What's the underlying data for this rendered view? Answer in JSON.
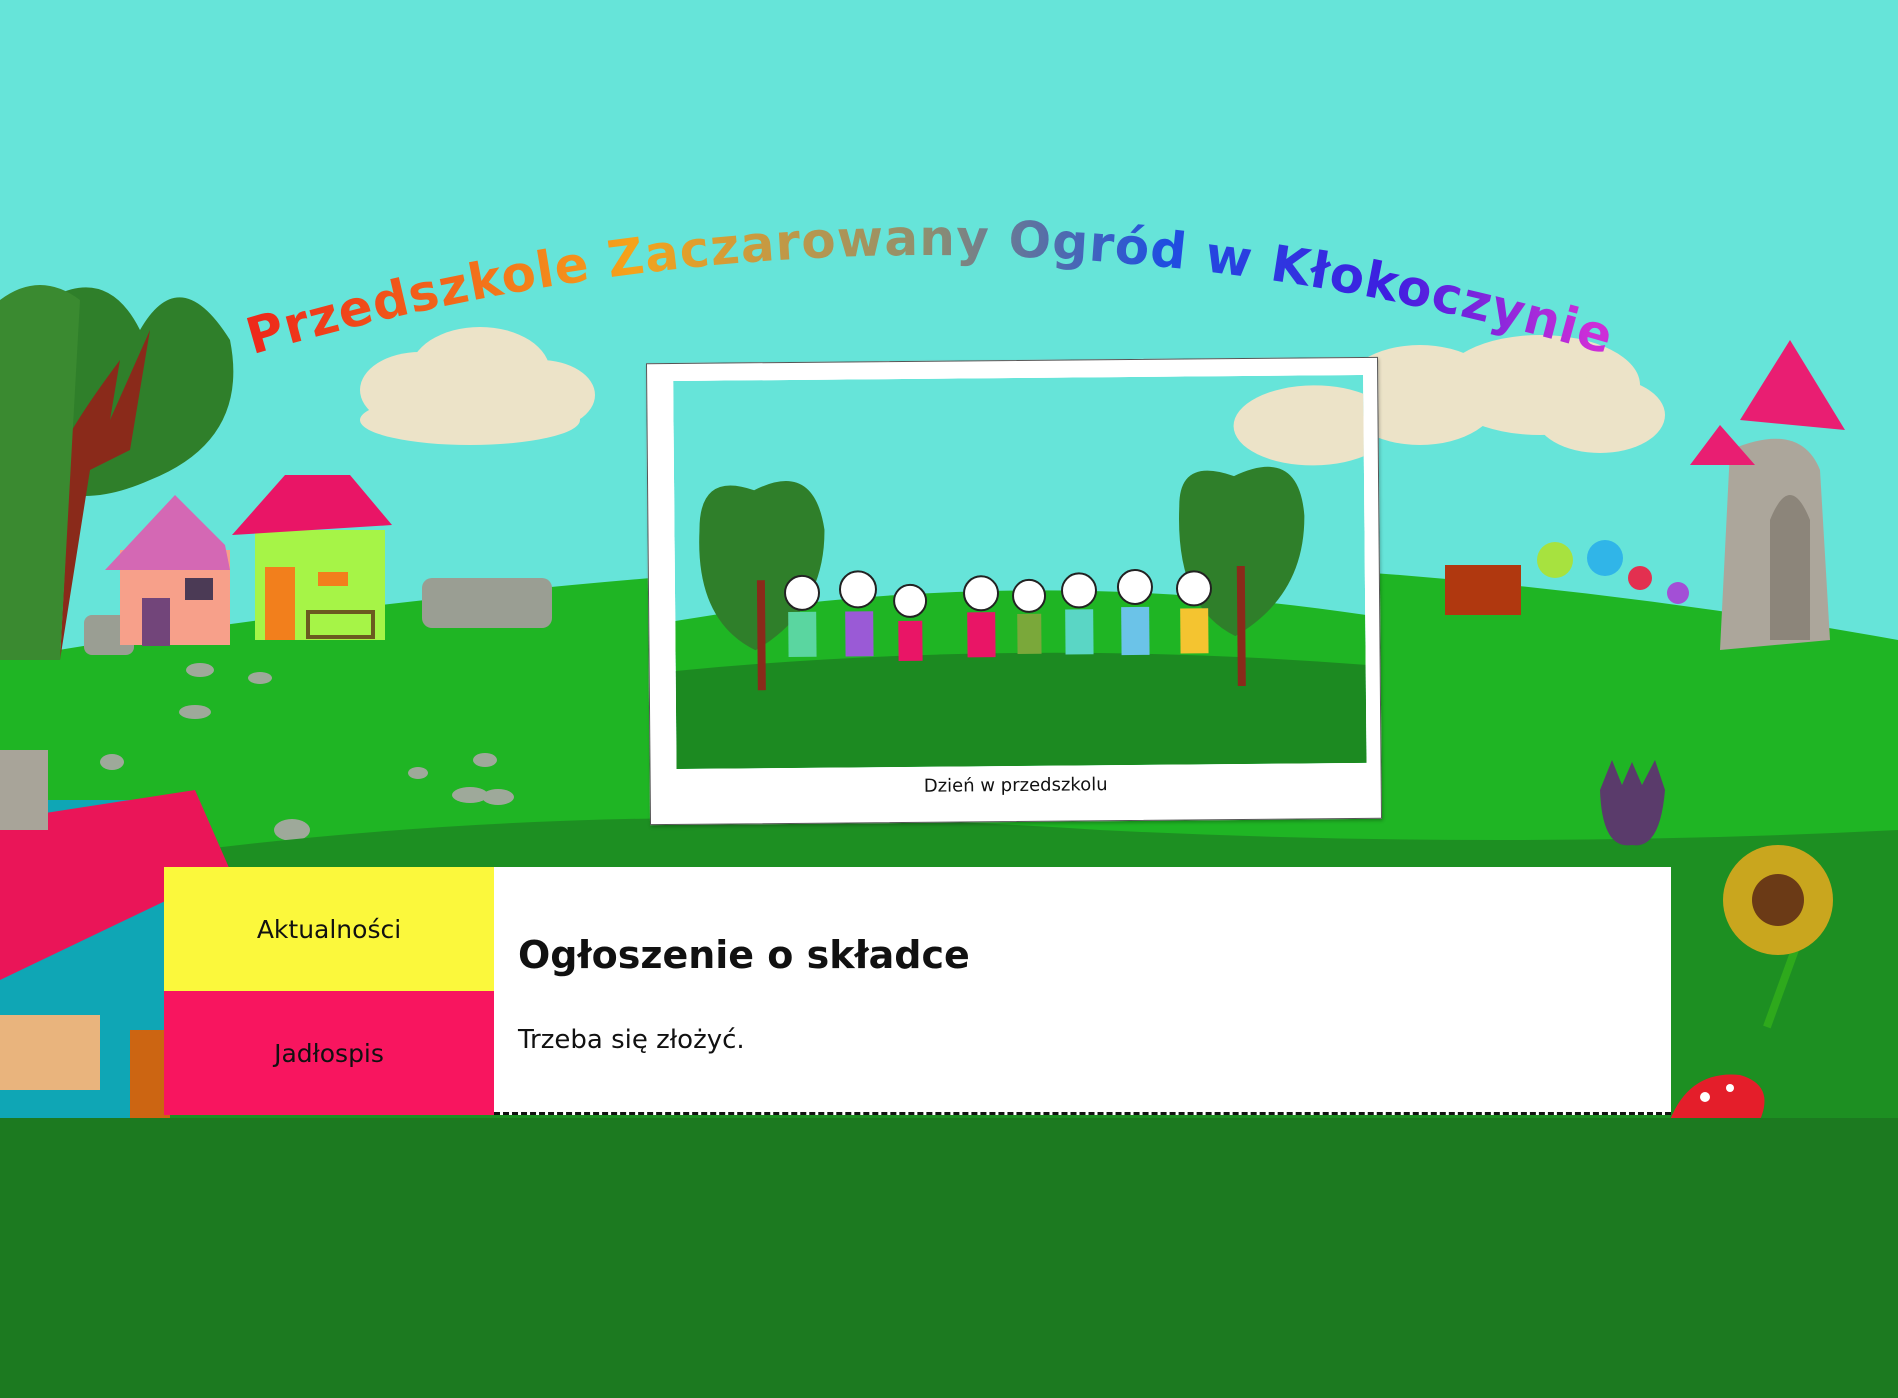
{
  "site": {
    "title": "Przedszkole Zaczarowany Ogród w Kłokoczynie"
  },
  "photo": {
    "caption": "Dzień w przedszkolu"
  },
  "menu": {
    "items": [
      {
        "label": "Aktualności",
        "color": "#fbf83c"
      },
      {
        "label": "Jadłospis",
        "color": "#f8155f"
      }
    ]
  },
  "article": {
    "title": "Ogłoszenie o składce",
    "body": "Trzeba się złożyć."
  },
  "colors": {
    "sky": "#66e4d9",
    "grass_light": "#1fb524",
    "grass_dark": "#1c7a20"
  }
}
